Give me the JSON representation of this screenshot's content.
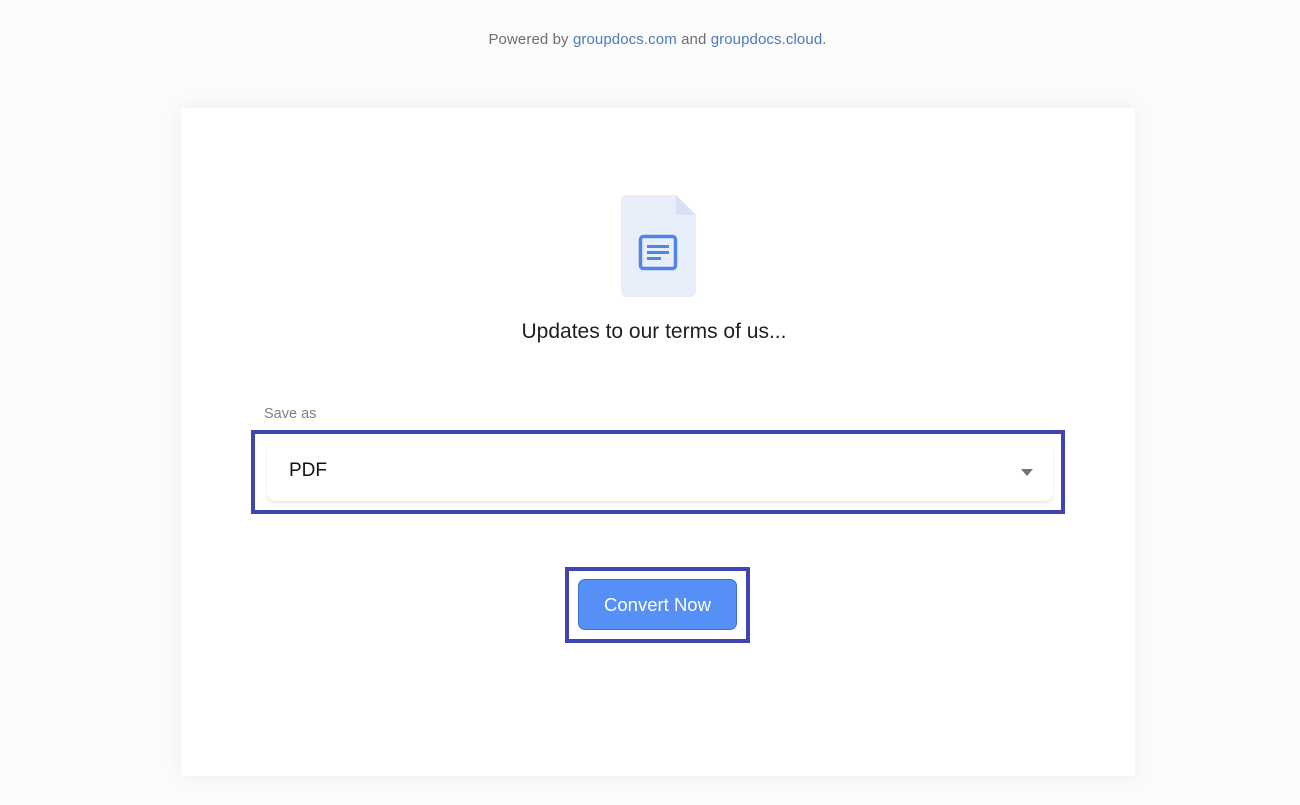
{
  "header": {
    "powered_prefix": "Powered by",
    "link1": "groupdocs.com",
    "conjunction": "and",
    "link2": "groupdocs.cloud",
    "suffix": "."
  },
  "card": {
    "file_icon": "document-icon",
    "file_name": "Updates to our terms of us...",
    "save_as_label": "Save as",
    "format_select": {
      "selected": "PDF",
      "icon": "chevron-down-icon"
    },
    "convert_button": "Convert Now"
  },
  "colors": {
    "accent": "#5690f7",
    "highlight_border": "#3f44b0",
    "link": "#4d7bb9",
    "icon_bg": "#e8eef9",
    "icon_fg": "#4f86e6"
  }
}
